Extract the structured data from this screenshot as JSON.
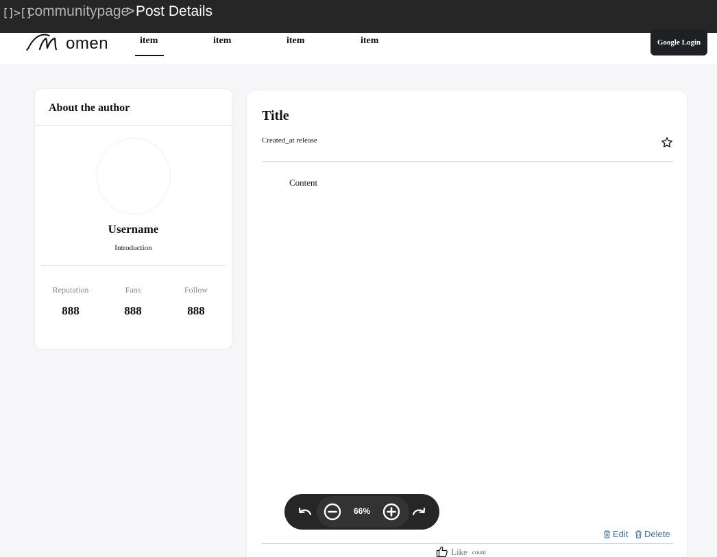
{
  "titlebar": {
    "icon": "[]>[]",
    "breadcrumb": "communitypage",
    "separator": ">",
    "page": "Post Details"
  },
  "navbar": {
    "logo_text": "omen",
    "items": [
      {
        "label": "item",
        "active": true
      },
      {
        "label": "item",
        "active": false
      },
      {
        "label": "item",
        "active": false
      },
      {
        "label": "item",
        "active": false
      }
    ],
    "login_label": "Google Login"
  },
  "author": {
    "heading": "About the author",
    "username": "Username",
    "introduction": "Introduction",
    "stats": [
      {
        "label": "Reputation",
        "value": "888"
      },
      {
        "label": "Fans",
        "value": "888"
      },
      {
        "label": "Follow",
        "value": "888"
      }
    ]
  },
  "post": {
    "title": "Title",
    "meta": "Created_at release",
    "content": "Content",
    "edit_label": "Edit",
    "delete_label": "Delete",
    "like_label": "Like",
    "like_count": "count"
  },
  "zoom": {
    "level": "66%"
  },
  "colors": {
    "accent_link": "#2f6fbf",
    "dark": "#262626",
    "background": "#f6f6f8"
  }
}
